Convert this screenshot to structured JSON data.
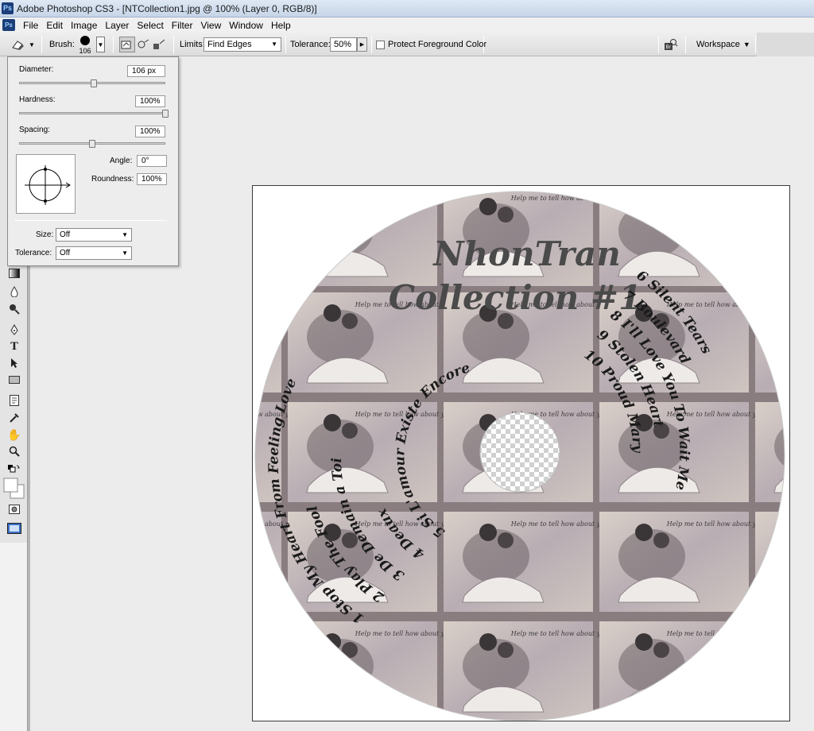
{
  "window": {
    "app_icon": "Ps",
    "title": "Adobe Photoshop CS3 - [NTCollection1.jpg @ 100% (Layer 0, RGB/8)]"
  },
  "menu": {
    "logo": "Ps",
    "items": [
      "File",
      "Edit",
      "Image",
      "Layer",
      "Select",
      "Filter",
      "View",
      "Window",
      "Help"
    ]
  },
  "options": {
    "brush_label": "Brush:",
    "brush_size": "106",
    "limits_label": "Limits:",
    "limits_value": "Find Edges",
    "tolerance_label": "Tolerance:",
    "tolerance_value": "50%",
    "protect_label": "Protect Foreground Color",
    "protect_checked": false,
    "workspace_label": "Workspace"
  },
  "brush_panel": {
    "diameter_label": "Diameter:",
    "diameter_value": "106 px",
    "diameter_slider": 0.51,
    "hardness_label": "Hardness:",
    "hardness_value": "100%",
    "hardness_slider": 1.0,
    "spacing_label": "Spacing:",
    "spacing_value": "100%",
    "spacing_slider": 0.5,
    "angle_label": "Angle:",
    "angle_value": "0°",
    "roundness_label": "Roundness:",
    "roundness_value": "100%",
    "size_label": "Size:",
    "size_value": "Off",
    "tolerance_label": "Tolerance:",
    "tolerance_value": "Off"
  },
  "document": {
    "tile_caption": "Help me to tell how about you",
    "disc_title_line1": "NhonTran",
    "disc_title_line2": "Collection #1",
    "left_tracks": [
      "1 Stop My Heart From Feeling Love",
      "2 Play The Fool",
      "3 De Demain a Toi",
      "4 Deaux",
      "5 Si L'amour Existe Encore"
    ],
    "right_tracks": [
      "6 Silent Tears",
      "7 Boulevard",
      "8 I'll Love You To Wait Me",
      "9 Stolen Heart",
      "10 Proud Mary"
    ]
  },
  "colors": {
    "titlebar": "#c6d5e8",
    "disc_frame": "#8a7d80",
    "disc_text": "#1a1a1a",
    "title_text": "#4a4a4a"
  }
}
